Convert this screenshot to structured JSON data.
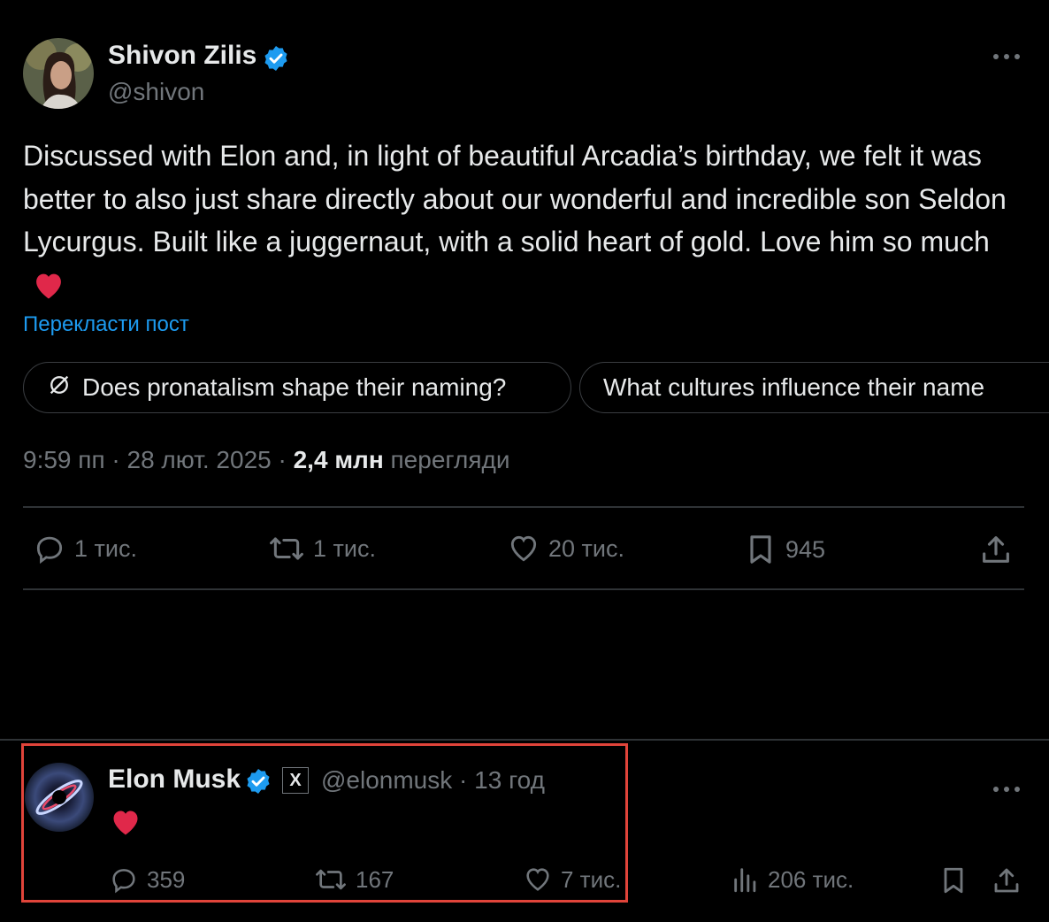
{
  "post": {
    "author_name": "Shivon Zilis",
    "handle": "@shivon",
    "text": "Discussed with Elon and, in light of beautiful Arcadia’s birthday, we felt it was better to also just share directly about our wonderful and incredible son Seldon Lycurgus. Built like a juggernaut, with a solid heart of gold. Love him so much",
    "emoji": "❤️",
    "translate_label": "Перекласти пост",
    "chips": [
      "Does pronatalism shape their naming?",
      "What cultures influence their name"
    ],
    "time": "9:59 пп",
    "date": "28 лют. 2025",
    "views_count": "2,4 млн",
    "views_label": "перегляди",
    "replies": "1 тис.",
    "reposts": "1 тис.",
    "likes": "20 тис.",
    "bookmarks": "945",
    "icons": {
      "more": "more-icon",
      "verified": "verified-badge-icon",
      "reply": "reply-icon",
      "repost": "repost-icon",
      "like": "heart-icon",
      "bookmark": "bookmark-icon",
      "share": "share-icon",
      "grok": "grok-icon"
    }
  },
  "reply": {
    "author_name": "Elon Musk",
    "handle": "@elonmusk",
    "time_ago": "13 год",
    "emoji": "❤️",
    "replies": "359",
    "reposts": "167",
    "likes": "7 тис.",
    "views": "206 тис.",
    "affiliate_badge": "X"
  },
  "colors": {
    "accent": "#1d9bf0",
    "muted": "#71767b",
    "highlight_box": "#e0443a",
    "heart": "#e0284a"
  }
}
